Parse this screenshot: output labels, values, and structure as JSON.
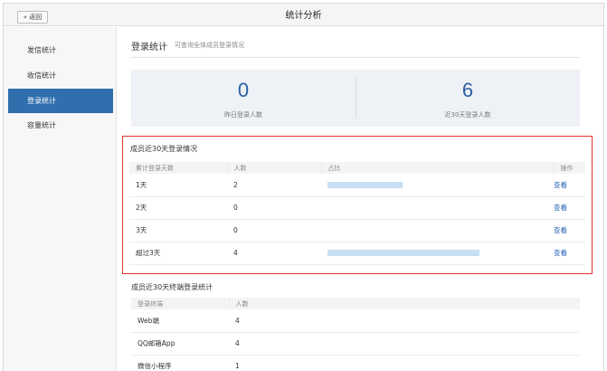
{
  "header": {
    "back_label": "« 返回",
    "title": "统计分析"
  },
  "sidebar": {
    "items": [
      {
        "label": "发信统计"
      },
      {
        "label": "收信统计"
      },
      {
        "label": "登录统计"
      },
      {
        "label": "容量统计"
      }
    ],
    "active_index": 2
  },
  "main": {
    "title": "登录统计",
    "subtitle": "可查询全体成员登录情况",
    "stats": [
      {
        "value": "0",
        "label": "昨日登录人数"
      },
      {
        "value": "6",
        "label": "近30天登录人数"
      }
    ],
    "recent": {
      "title": "成员近30天登录情况",
      "columns": [
        "累计登录天数",
        "人数",
        "占比",
        "操作"
      ],
      "rows": [
        {
          "days": "1天",
          "count": "2",
          "ratio": 0.33,
          "action": "查看"
        },
        {
          "days": "2天",
          "count": "0",
          "ratio": 0,
          "action": "查看"
        },
        {
          "days": "3天",
          "count": "0",
          "ratio": 0,
          "action": "查看"
        },
        {
          "days": "超过3天",
          "count": "4",
          "ratio": 0.67,
          "action": "查看"
        }
      ]
    },
    "terminals": {
      "title": "成员近30天终端登录统计",
      "columns": [
        "登录终端",
        "人数"
      ],
      "rows": [
        {
          "terminal": "Web端",
          "count": "4"
        },
        {
          "terminal": "QQ邮箱App",
          "count": "4"
        },
        {
          "terminal": "微信小程序",
          "count": "1"
        }
      ]
    }
  },
  "colors": {
    "accent": "#2f6fad",
    "link": "#2a64b6",
    "highlight_border": "#e0342b",
    "bar": "#c7def3",
    "stat_value": "#2a5ea7"
  }
}
